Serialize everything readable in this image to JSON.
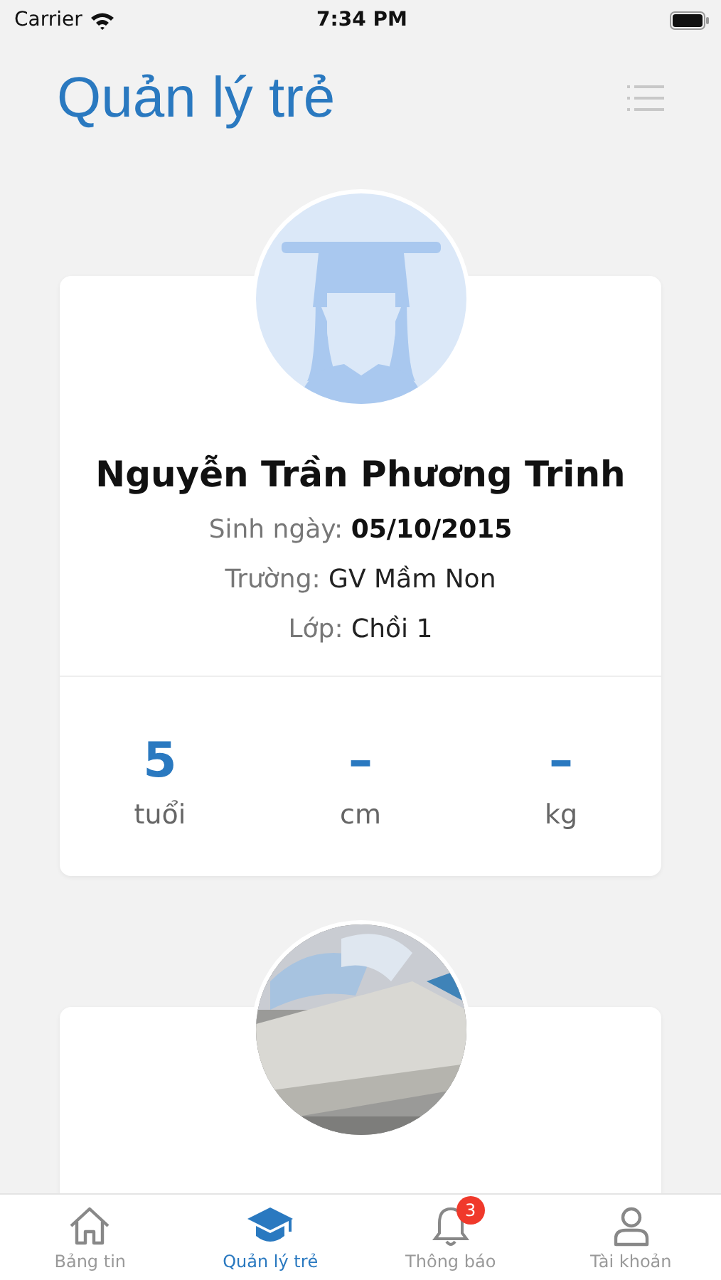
{
  "status_bar": {
    "carrier": "Carrier",
    "time": "7:34 PM"
  },
  "header": {
    "title": "Quản lý trẻ"
  },
  "students": [
    {
      "kind": "profile",
      "name": "Nguyễn Trần Phương Trinh",
      "details": [
        {
          "label": "Sinh ngày:",
          "value": "05/10/2015",
          "bold": true
        },
        {
          "label": "Trường:",
          "value": "GV Mầm Non",
          "bold": false
        },
        {
          "label": "Lớp:",
          "value": "Chồi 1",
          "bold": false
        }
      ],
      "stats": [
        {
          "value": "5",
          "unit": "tuổi"
        },
        {
          "value": "–",
          "unit": "cm"
        },
        {
          "value": "–",
          "unit": "kg"
        }
      ]
    },
    {
      "kind": "picture"
    }
  ],
  "tab_bar": [
    {
      "kind": "home",
      "label": "Bảng tin",
      "selected": false
    },
    {
      "kind": "cap",
      "label": "Quản lý trẻ",
      "selected": true
    },
    {
      "kind": "bell",
      "label": "Thông báo",
      "selected": false,
      "badge": "3"
    },
    {
      "kind": "person",
      "label": "Tài khoản",
      "selected": false
    }
  ]
}
